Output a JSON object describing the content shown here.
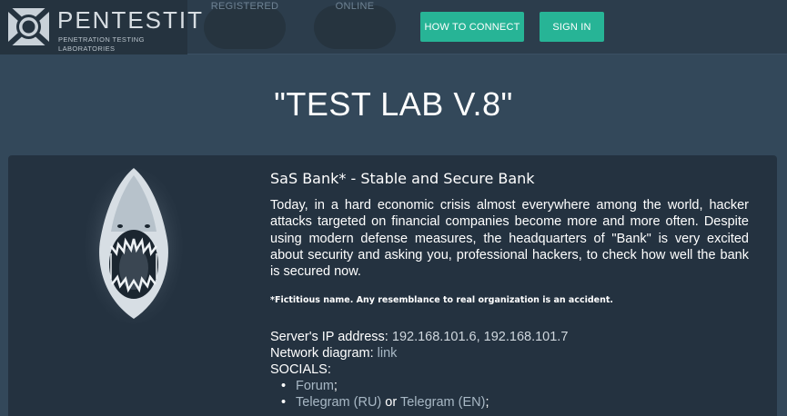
{
  "header": {
    "logo_name": "PENTESTIT",
    "logo_tagline": "PENETRATION TESTING LABORATORIES",
    "stats": [
      {
        "label": "REGISTERED"
      },
      {
        "label": "ONLINE"
      }
    ],
    "how_to_connect_label": "HOW TO CONNECT",
    "sign_in_label": "SIGN IN"
  },
  "hero": {
    "title": "\"TEST LAB V.8\""
  },
  "lab": {
    "title": "SaS Bank* - Stable and Secure Bank",
    "description": "Today, in a hard economic crisis almost everywhere among the world, hacker attacks targeted on financial companies become more and more often. Despite using modern defense measures, the headquarters of \"Bank\" is very excited about security and asking you, professional hackers, to check how well the bank is secured now.",
    "note": "*Fictitious name. Any resemblance to real organization is an accident.",
    "server_ip_label": "Server's IP address:",
    "server_ip_value": "192.168.101.6, 192.168.101.7",
    "network_diagram_label": "Network diagram:",
    "network_diagram_link": "link",
    "socials_label": "SOCIALS:",
    "socials": {
      "forum": "Forum",
      "forum_suffix": ";",
      "telegram_ru": "Telegram (RU)",
      "or": "or",
      "telegram_en": "Telegram (EN)",
      "telegram_suffix": ";"
    }
  },
  "colors": {
    "page_bg": "#33485a",
    "header_bg": "#2c3d4c",
    "card_bg": "#243240",
    "accent": "#27b496"
  }
}
